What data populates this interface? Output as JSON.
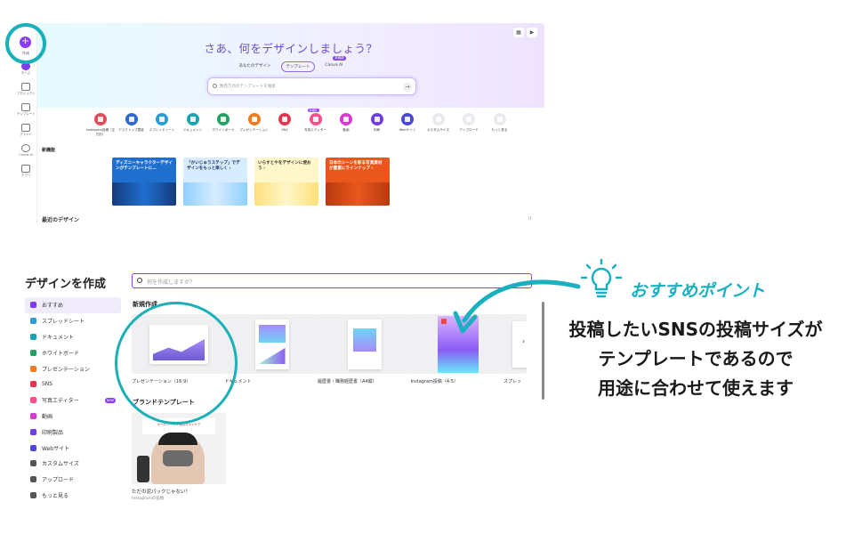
{
  "top": {
    "create_label": "作成",
    "sidebar": [
      "ホーム",
      "プロジェクト",
      "テンプレート",
      "ブランド",
      "Canva AI",
      "アプリ"
    ],
    "hero_title": "さあ、何をデザインしましょう？",
    "hero_tabs": [
      "あなたのデザイン",
      "テンプレート",
      "Canva AI"
    ],
    "canva_ai_badge": "新機能",
    "search_placeholder": "数百万点のテンプレートを検索",
    "categories": [
      {
        "label": "Instagram投稿（正方形）",
        "color": "#e34b57"
      },
      {
        "label": "デスクトップ壁紙",
        "color": "#2f69d6"
      },
      {
        "label": "スプレッドシート",
        "color": "#2a9cd8"
      },
      {
        "label": "ドキュメント",
        "color": "#1aa3b0"
      },
      {
        "label": "ホワイトボード",
        "color": "#1fa463"
      },
      {
        "label": "プレゼンテーション",
        "color": "#f07c1e"
      },
      {
        "label": "SNS",
        "color": "#e8344e"
      },
      {
        "label": "写真エディター",
        "color": "#ff4d8d"
      },
      {
        "label": "動画",
        "color": "#d63ccf"
      },
      {
        "label": "印刷",
        "color": "#6f3de0"
      },
      {
        "label": "Webサイト",
        "color": "#4b48d6"
      },
      {
        "label": "カスタムサイズ",
        "color": "#e9e9ee"
      },
      {
        "label": "アップロード",
        "color": "#e9e9ee"
      },
      {
        "label": "もっと見る",
        "color": "#e9e9ee"
      }
    ],
    "cat_new_badge": "新機能",
    "new_features_label": "新機能",
    "banners": [
      {
        "text": "ディズニーキャラクターデザインがテンプレートに…",
        "bg": "#1f6fcf",
        "fg": "#ffffff",
        "art": "#163b7c"
      },
      {
        "text": "「かいじゅうステップ」でデザインをもっと楽しく ›",
        "bg": "#d7ecff",
        "fg": "#1a2a5a",
        "art": "#8fd0ff"
      },
      {
        "text": "いらすとやをデザインに使おう ›",
        "bg": "#fff6c9",
        "fg": "#333333",
        "art": "#ffe07a"
      },
      {
        "text": "日本のシーンを彩る写真素材が豊富にラインナップ ›",
        "bg": "#e9571c",
        "fg": "#ffffff",
        "art": "#b73b10"
      }
    ],
    "recent_label": "最近のデザイン"
  },
  "bottom": {
    "panel_title": "デザインを作成",
    "search_placeholder": "何を作成しますか？",
    "menu": [
      {
        "label": "おすすめ",
        "color": "#7d3cf0"
      },
      {
        "label": "スプレッドシート",
        "color": "#2a9cd8"
      },
      {
        "label": "ドキュメント",
        "color": "#1aa3b0"
      },
      {
        "label": "ホワイトボード",
        "color": "#1fa463"
      },
      {
        "label": "プレゼンテーション",
        "color": "#f07c1e"
      },
      {
        "label": "SNS",
        "color": "#e8344e"
      },
      {
        "label": "写真エディター",
        "color": "#ff4d8d"
      },
      {
        "label": "動画",
        "color": "#d63ccf"
      },
      {
        "label": "印刷製品",
        "color": "#6f3de0"
      },
      {
        "label": "Webサイト",
        "color": "#4b48d6"
      },
      {
        "label": "カスタムサイズ",
        "color": "#555555"
      },
      {
        "label": "アップロード",
        "color": "#555555"
      },
      {
        "label": "もっと見る",
        "color": "#555555"
      }
    ],
    "menu_new_badge": "NEW",
    "sec_new_title": "新規作成",
    "templates": [
      {
        "label": "プレゼンテーション（16:9）"
      },
      {
        "label": "ドキュメント"
      },
      {
        "label": "履歴書・職務経歴書（A4縦）"
      },
      {
        "label": "Instagram投稿（4:5）"
      },
      {
        "label": "スプレッ"
      }
    ],
    "sec_brand_title": "ブランドテンプレート",
    "brand_card_caption": "オールシーズン美肌スキンケア",
    "brand_name": "ただの泥パックじゃない！",
    "brand_sub": "Instagramの投稿"
  },
  "callout": {
    "title": "おすすめポイント",
    "lines": [
      "投稿したいSNSの投稿サイズが",
      "テンプレートであるので",
      "用途に合わせて使えます"
    ],
    "accent": "#19b0c0"
  }
}
